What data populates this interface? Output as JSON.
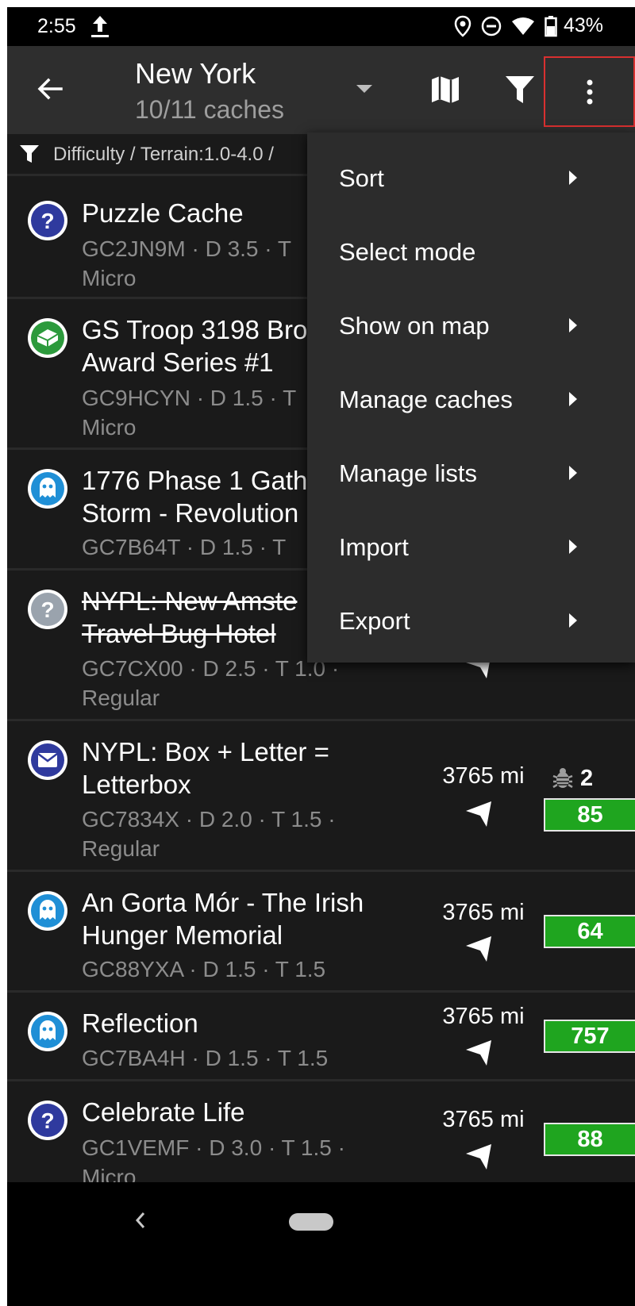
{
  "status_bar": {
    "time": "2:55",
    "battery_percent": "43%"
  },
  "toolbar": {
    "title": "New York",
    "subtitle": "10/11 caches"
  },
  "filter_bar": {
    "text": "Difficulty / Terrain:1.0-4.0 /"
  },
  "caches": [
    {
      "name": "Puzzle Cache",
      "meta": "GC2JN9M · D 3.5 · T",
      "meta2": "Micro",
      "icon": "puzzle-icon"
    },
    {
      "name": "GS Troop 3198 Bro",
      "name2": "Award Series #1",
      "meta": "GC9HCYN · D 1.5 · T",
      "meta2": "Micro",
      "icon": "traditional-cache-icon"
    },
    {
      "name": "1776 Phase 1 Gath",
      "name2": "Storm - Revolution",
      "meta": "GC7B64T · D 1.5 · T",
      "icon": "ghost-icon"
    },
    {
      "name": "NYPL: New Amste",
      "name2": "Travel Bug Hotel",
      "meta": "GC7CX00 · D 2.5 · T 1.0 ·",
      "meta2": "Regular",
      "icon": "puzzle-icon-disabled"
    },
    {
      "name": "NYPL: Box + Letter =",
      "name2": "Letterbox",
      "meta": "GC7834X · D 2.0 · T 1.5 ·",
      "meta2": "Regular",
      "distance": "3765 mi",
      "favorites": "85",
      "trackables": "2",
      "icon": "letterbox-icon"
    },
    {
      "name": "An Gorta Mór - The Irish",
      "name2": "Hunger Memorial",
      "meta": "GC88YXA · D 1.5 · T 1.5",
      "distance": "3765 mi",
      "favorites": "64",
      "icon": "ghost-icon"
    },
    {
      "name": "Reflection",
      "meta": "GC7BA4H · D 1.5 · T 1.5",
      "distance": "3765 mi",
      "favorites": "757",
      "icon": "ghost-icon"
    },
    {
      "name": "Celebrate Life",
      "meta": "GC1VEMF · D 3.0 · T 1.5 ·",
      "meta2": "Micro",
      "distance": "3765 mi",
      "favorites": "88",
      "icon": "puzzle-icon"
    }
  ],
  "menu": {
    "items": [
      {
        "label": "Sort",
        "submenu": true
      },
      {
        "label": "Select mode",
        "submenu": false
      },
      {
        "label": "Show on map",
        "submenu": true
      },
      {
        "label": "Manage caches",
        "submenu": true
      },
      {
        "label": "Manage lists",
        "submenu": true
      },
      {
        "label": "Import",
        "submenu": true
      },
      {
        "label": "Export",
        "submenu": true
      }
    ]
  },
  "colors": {
    "puzzle": "#2f3a9e",
    "traditional": "#2c9a3c",
    "ghost": "#1f8fd6",
    "disabled": "#9aa3ad",
    "favorite_badge": "#1fa51f",
    "highlight_border": "#d93030"
  }
}
